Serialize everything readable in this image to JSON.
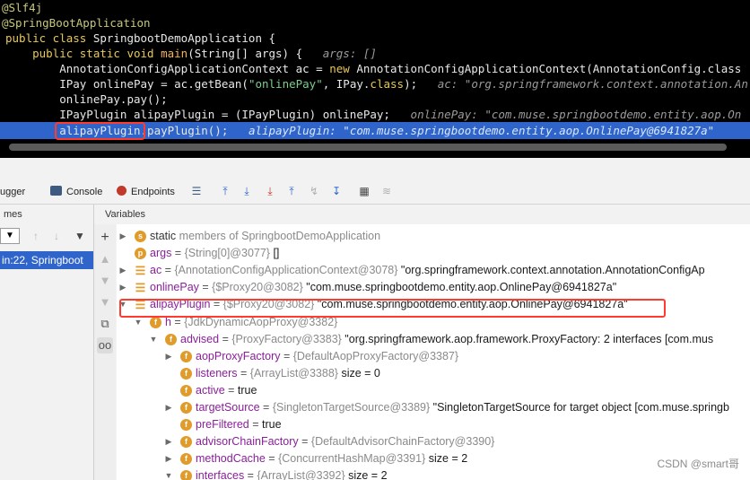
{
  "editor": {
    "lines": [
      {
        "segments": [
          {
            "t": "@Slf4j",
            "c": "ann"
          }
        ]
      },
      {
        "segments": [
          {
            "t": "@SpringBootApplication",
            "c": "ann"
          }
        ]
      },
      {
        "segments": [
          {
            "t": "public class ",
            "c": "kw"
          },
          {
            "t": "SpringbootDemoApplication {",
            "c": "cls"
          }
        ]
      },
      {
        "segments": [
          {
            "t": "    public static void ",
            "c": "kw"
          },
          {
            "t": "main",
            "c": "fn"
          },
          {
            "t": "(String[] args) {   ",
            "c": "cls"
          },
          {
            "t": "args: []",
            "c": "hint"
          }
        ]
      },
      {
        "segments": [
          {
            "t": "        AnnotationConfigApplicationContext ac = ",
            "c": "cls"
          },
          {
            "t": "new ",
            "c": "kw"
          },
          {
            "t": "AnnotationConfigApplicationContext(AnnotationConfig.class",
            "c": "cls"
          }
        ]
      },
      {
        "segments": [
          {
            "t": "        IPay onlinePay = ac.getBean(",
            "c": "cls"
          },
          {
            "t": "\"onlinePay\"",
            "c": "str"
          },
          {
            "t": ", IPay.",
            "c": "cls"
          },
          {
            "t": "class",
            "c": "kw"
          },
          {
            "t": ");   ",
            "c": "cls"
          },
          {
            "t": "ac: \"org.springframework.context.annotation.An",
            "c": "hint"
          }
        ]
      },
      {
        "segments": [
          {
            "t": "        onlinePay.pay();",
            "c": "cls"
          }
        ]
      },
      {
        "segments": [
          {
            "t": "        IPayPlugin alipayPlugin = (IPayPlugin) onlinePay;   ",
            "c": "cls"
          },
          {
            "t": "onlinePay: \"com.muse.springbootdemo.entity.aop.On",
            "c": "hint"
          }
        ]
      },
      {
        "segments": [
          {
            "t": "        alipayPlugin.payPlugin();   ",
            "c": "cls"
          },
          {
            "t": "alipayPlugin: \"com.muse.springbootdemo.entity.aop.OnlinePay@6941827a\"",
            "c": "hint-sel"
          }
        ]
      }
    ]
  },
  "toolbar": {
    "debugger_tab": "ugger",
    "console_tab": "Console",
    "endpoints_tab": "Endpoints"
  },
  "frames": {
    "header": "mes",
    "selected_frame": "in:22, Springboot"
  },
  "variables": {
    "header": "Variables",
    "rows": [
      {
        "indent": 0,
        "arrow": "▶",
        "icon": "s",
        "name": "static",
        "rest": " members of SpringbootDemoApplication",
        "type": "",
        "value": "",
        "name_style": "static"
      },
      {
        "indent": 0,
        "arrow": "",
        "icon": "p",
        "name": "args",
        "rest": "",
        "type": "{String[0]@3077}",
        "value": " []"
      },
      {
        "indent": 0,
        "arrow": "▶",
        "icon": "lst",
        "name": "ac",
        "rest": "",
        "type": "{AnnotationConfigApplicationContext@3078}",
        "value": " \"org.springframework.context.annotation.AnnotationConfigAp"
      },
      {
        "indent": 0,
        "arrow": "▶",
        "icon": "lst",
        "name": "onlinePay",
        "rest": "",
        "type": "{$Proxy20@3082}",
        "value": " \"com.muse.springbootdemo.entity.aop.OnlinePay@6941827a\""
      },
      {
        "indent": 0,
        "arrow": "▼",
        "icon": "lst",
        "name": "alipayPlugin",
        "rest": "",
        "type": "{$Proxy20@3082}",
        "value": " \"com.muse.springbootdemo.entity.aop.OnlinePay@6941827a\""
      },
      {
        "indent": 1,
        "arrow": "▼",
        "icon": "f",
        "name": "h",
        "rest": "",
        "type": "{JdkDynamicAopProxy@3382}",
        "value": ""
      },
      {
        "indent": 2,
        "arrow": "▼",
        "icon": "f",
        "name": "advised",
        "rest": "",
        "type": "{ProxyFactory@3383}",
        "value": " \"org.springframework.aop.framework.ProxyFactory: 2 interfaces [com.mus"
      },
      {
        "indent": 3,
        "arrow": "▶",
        "icon": "f",
        "name": "aopProxyFactory",
        "rest": "",
        "type": "{DefaultAopProxyFactory@3387}",
        "value": ""
      },
      {
        "indent": 3,
        "arrow": "",
        "icon": "f",
        "name": "listeners",
        "rest": "",
        "type": "{ArrayList@3388}",
        "value": "  size = 0"
      },
      {
        "indent": 3,
        "arrow": "",
        "icon": "f",
        "name": "active",
        "rest": "",
        "type": "",
        "value": " true"
      },
      {
        "indent": 3,
        "arrow": "▶",
        "icon": "f",
        "name": "targetSource",
        "rest": "",
        "type": "{SingletonTargetSource@3389}",
        "value": " \"SingletonTargetSource for target object [com.muse.springb"
      },
      {
        "indent": 3,
        "arrow": "",
        "icon": "f",
        "name": "preFiltered",
        "rest": "",
        "type": "",
        "value": " true"
      },
      {
        "indent": 3,
        "arrow": "▶",
        "icon": "f",
        "name": "advisorChainFactory",
        "rest": "",
        "type": "{DefaultAdvisorChainFactory@3390}",
        "value": ""
      },
      {
        "indent": 3,
        "arrow": "▶",
        "icon": "f",
        "name": "methodCache",
        "rest": "",
        "type": "{ConcurrentHashMap@3391}",
        "value": "  size = 2"
      },
      {
        "indent": 3,
        "arrow": "▼",
        "icon": "f",
        "name": "interfaces",
        "rest": "",
        "type": "{ArrayList@3392}",
        "value": "  size = 2"
      }
    ]
  },
  "watermark": "CSDN @smart哥",
  "colors": {
    "selection": "#2f65ca",
    "highlight_box": "#ff3b30",
    "field_icon": "#e09b2a"
  }
}
